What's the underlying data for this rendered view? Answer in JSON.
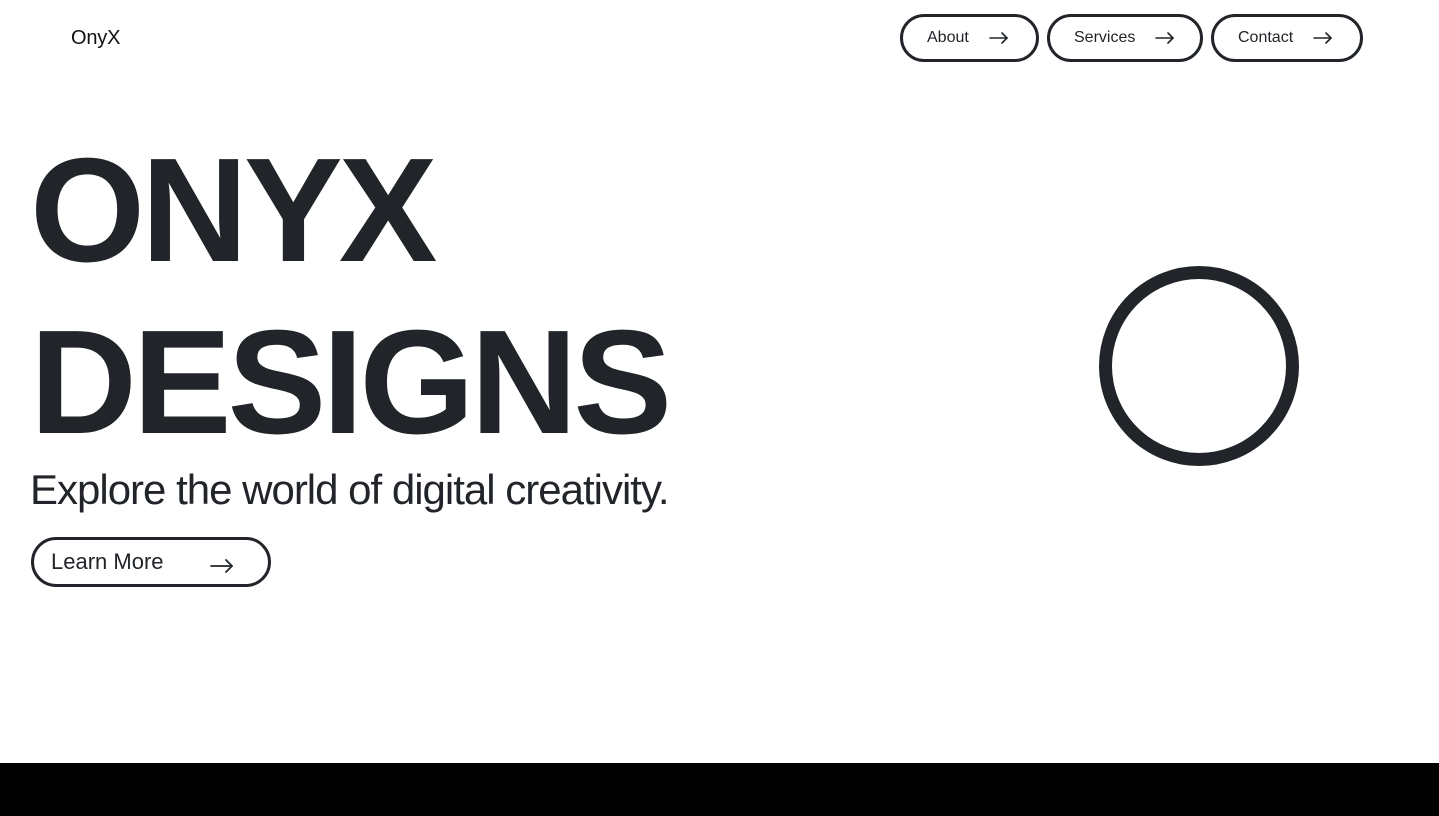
{
  "brand": {
    "name": "OnyX"
  },
  "nav": {
    "items": [
      {
        "label": "About",
        "icon": "arrow-right-icon"
      },
      {
        "label": "Services",
        "icon": "arrow-right-icon"
      },
      {
        "label": "Contact",
        "icon": "arrow-right-icon"
      }
    ]
  },
  "hero": {
    "title_line1": "ONYX",
    "title_line2": "DESIGNS",
    "tagline": "Explore the world of digital creativity.",
    "cta_label": "Learn More",
    "cta_icon": "arrow-right-icon"
  },
  "colors": {
    "text": "#212529",
    "background": "#ffffff",
    "footer": "#000000"
  }
}
